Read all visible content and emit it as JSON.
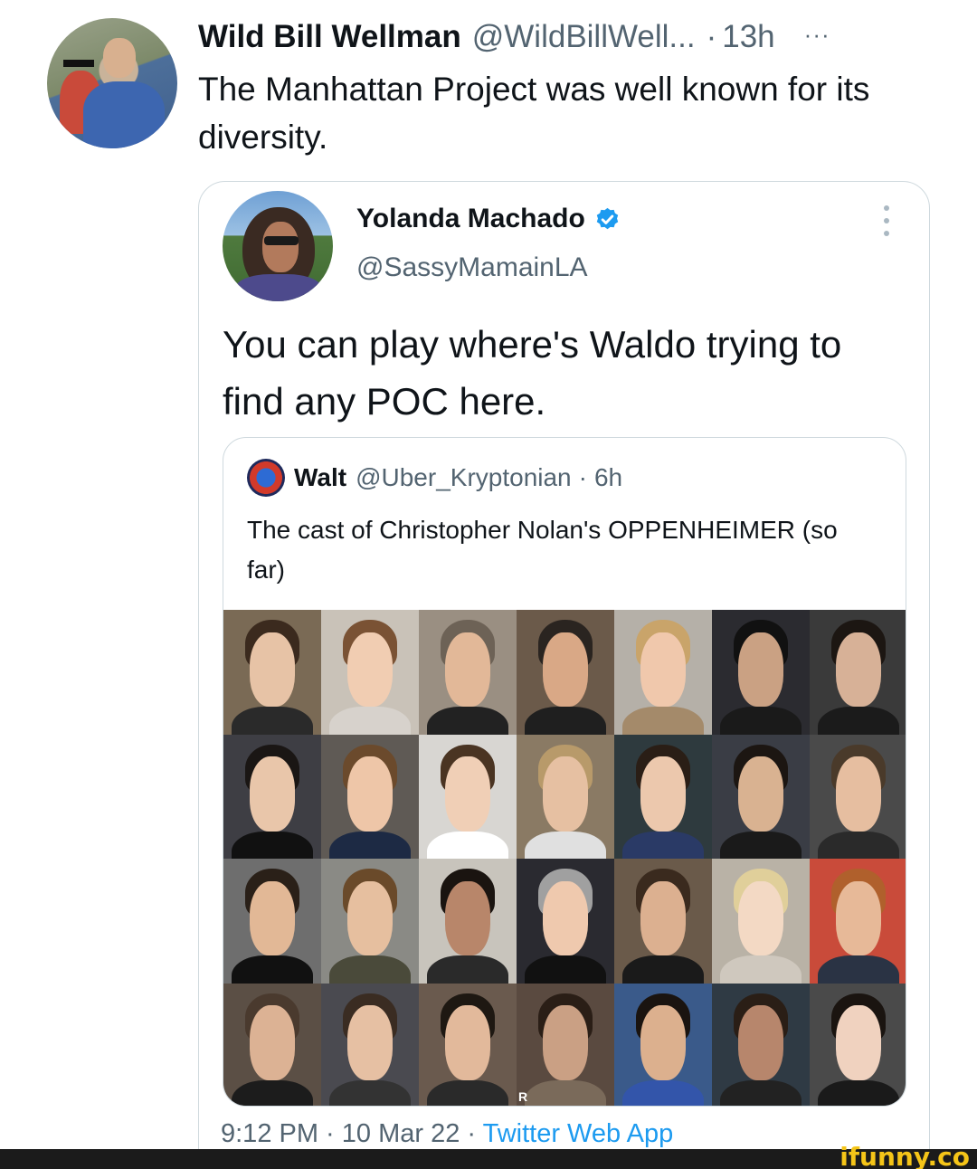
{
  "outer_tweet": {
    "display_name": "Wild Bill Wellman",
    "handle": "@WildBillWell...",
    "separator": "·",
    "time_ago": "13h",
    "more_label": "···",
    "text": "The Manhattan Project was well known for its diversity."
  },
  "embedded_tweet": {
    "display_name": "Yolanda Machado",
    "handle": "@SassyMamainLA",
    "verified": true,
    "text": "You can play where's Waldo trying to find any POC here.",
    "footer": {
      "time": "9:12 PM · 10 Mar 22 · ",
      "source": "Twitter Web App"
    }
  },
  "quoted_tweet": {
    "display_name": "Walt",
    "handle": "@Uber_Kryptonian",
    "separator": "·",
    "time_ago": "6h",
    "text": "The cast of Christopher Nolan's OPPENHEIMER (so far)",
    "photo_badge": "R"
  },
  "watermark": "ifunny.co",
  "colors": {
    "muted": "#536471",
    "link": "#1d9bf0",
    "border": "#cfd9de",
    "verified": "#1d9bf0"
  },
  "icons": {
    "verified": "verified-badge-icon",
    "more": "more-horizontal-icon",
    "kebab": "more-vertical-icon"
  }
}
